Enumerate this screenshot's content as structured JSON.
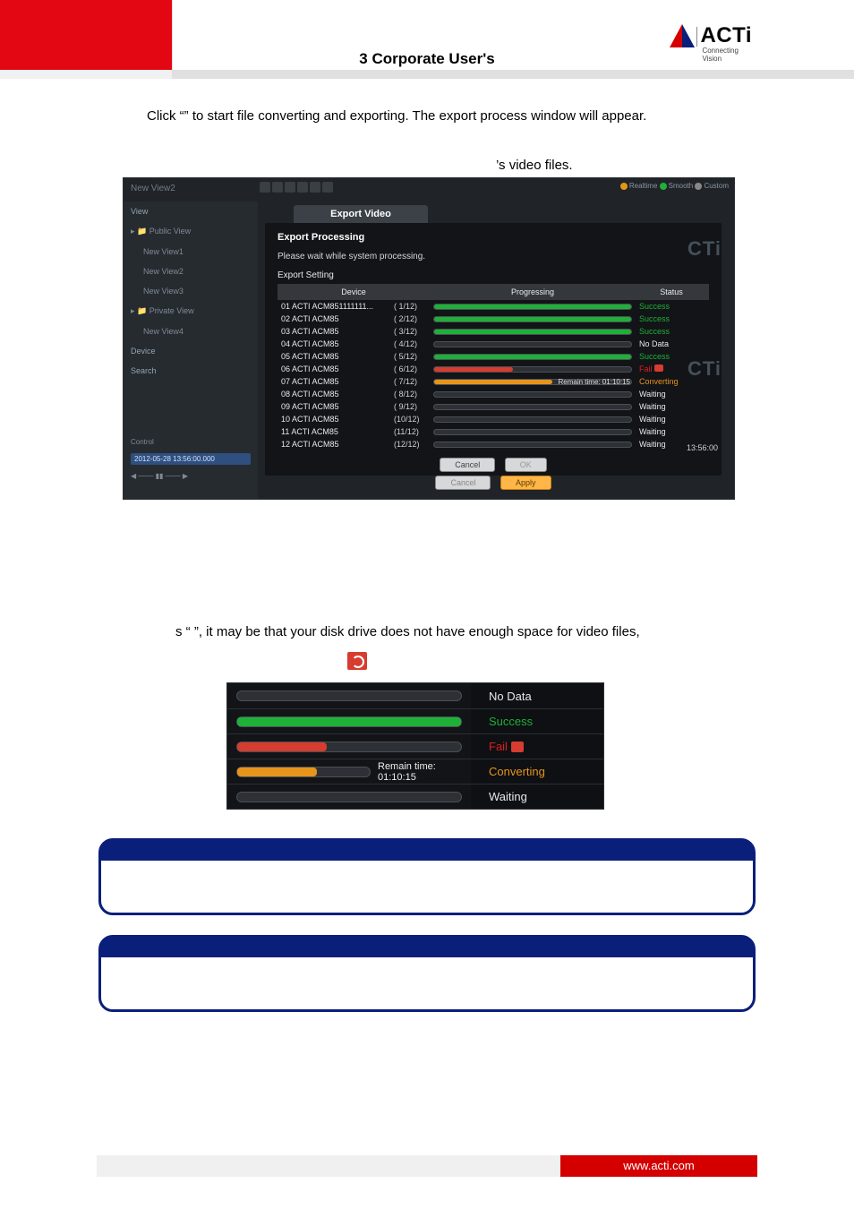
{
  "brand": {
    "name": "ACTi",
    "tagline": "Connecting Vision"
  },
  "header": {
    "chapter": "3 Corporate User's"
  },
  "body": {
    "para1_pre": "Click “",
    "para1_bold": "",
    "para1_post": "” to start file converting and exporting. The export process window will appear.",
    "caption_right": "’s video files.",
    "para2": "s “        ”, it may be that your disk drive does not have enough space for video files,"
  },
  "dialog": {
    "title": "Export Video",
    "section": "Export Processing",
    "message": "Please wait while system processing.",
    "setting_label": "Export Setting",
    "columns": {
      "device": "Device",
      "progress": "Progressing",
      "status": "Status"
    },
    "buttons": {
      "cancel": "Cancel",
      "ok": "OK",
      "apply": "Apply",
      "cancel2": "Cancel"
    },
    "remain_label": "Remain time: ",
    "remain_value": "01:10:15",
    "clock": "13:56:00",
    "rows": [
      {
        "idx": "01",
        "name": "ACTI ACM851111111...",
        "count": "( 1/12)",
        "fill": 100,
        "color": "pf-green",
        "status": "Success",
        "css": "st-success"
      },
      {
        "idx": "02",
        "name": "ACTI ACM85",
        "count": "( 2/12)",
        "fill": 100,
        "color": "pf-green",
        "status": "Success",
        "css": "st-success"
      },
      {
        "idx": "03",
        "name": "ACTI ACM85",
        "count": "( 3/12)",
        "fill": 100,
        "color": "pf-green",
        "status": "Success",
        "css": "st-success"
      },
      {
        "idx": "04",
        "name": "ACTI ACM85",
        "count": "( 4/12)",
        "fill": 0,
        "color": "",
        "status": "No Data",
        "css": "st-nodata"
      },
      {
        "idx": "05",
        "name": "ACTI ACM85",
        "count": "( 5/12)",
        "fill": 100,
        "color": "pf-green",
        "status": "Success",
        "css": "st-success"
      },
      {
        "idx": "06",
        "name": "ACTI ACM85",
        "count": "( 6/12)",
        "fill": 40,
        "color": "pf-red",
        "status": "Fail ",
        "css": "st-fail",
        "retry": true
      },
      {
        "idx": "07",
        "name": "ACTI ACM85",
        "count": "( 7/12)",
        "fill": 60,
        "color": "pf-orange",
        "status": "Converting",
        "css": "st-converting",
        "remain": true
      },
      {
        "idx": "08",
        "name": "ACTI ACM85",
        "count": "( 8/12)",
        "fill": 0,
        "color": "",
        "status": "Waiting",
        "css": "st-waiting"
      },
      {
        "idx": "09",
        "name": "ACTI ACM85",
        "count": "( 9/12)",
        "fill": 0,
        "color": "",
        "status": "Waiting",
        "css": "st-waiting"
      },
      {
        "idx": "10",
        "name": "ACTI ACM85",
        "count": "(10/12)",
        "fill": 0,
        "color": "",
        "status": "Waiting",
        "css": "st-waiting"
      },
      {
        "idx": "11",
        "name": "ACTI ACM85",
        "count": "(11/12)",
        "fill": 0,
        "color": "",
        "status": "Waiting",
        "css": "st-waiting"
      },
      {
        "idx": "12",
        "name": "ACTI ACM85",
        "count": "(12/12)",
        "fill": 0,
        "color": "",
        "status": "Waiting",
        "css": "st-waiting"
      }
    ]
  },
  "sidebar": {
    "view_label": "View",
    "public": "Public View",
    "items1": [
      "New View1",
      "New View2",
      "New View3"
    ],
    "private": "Private View",
    "items2": [
      "New View4"
    ],
    "device_label": "Device",
    "search_label": "Search",
    "control_label": "Control",
    "timestamp": "2012-05-28 13:56:00.000"
  },
  "mini": {
    "rows": [
      {
        "fill": 0,
        "color": "",
        "status": "No Data",
        "css": "st-nodata"
      },
      {
        "fill": 100,
        "color": "pf-green",
        "status": "Success",
        "css": "st-success"
      },
      {
        "fill": 40,
        "color": "pf-red",
        "status": "Fail ",
        "css": "st-fail",
        "retry": true
      },
      {
        "fill": 60,
        "color": "pf-orange",
        "status": "Converting",
        "css": "st-converting",
        "remain": true
      },
      {
        "fill": 0,
        "color": "",
        "status": "Waiting",
        "css": "st-waiting"
      }
    ],
    "remain_label": "Remain time:   ",
    "remain_value": "01:10:15"
  },
  "footer": {
    "url": "www.acti.com"
  }
}
